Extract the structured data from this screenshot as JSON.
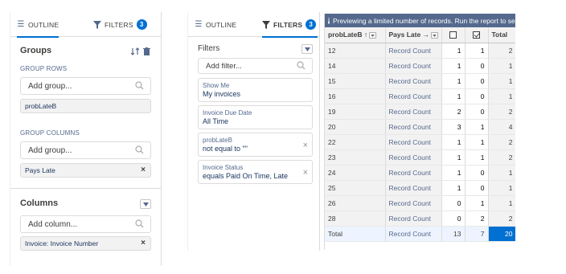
{
  "panel1": {
    "tabs": {
      "outline": "OUTLINE",
      "filters": "FILTERS",
      "filter_count": "3"
    },
    "groups": {
      "title": "Groups",
      "group_rows_label": "GROUP ROWS",
      "add_group_placeholder": "Add group...",
      "row_group": "probLateB",
      "group_columns_label": "GROUP COLUMNS",
      "column_group": "Pays Late"
    },
    "columns": {
      "title": "Columns",
      "add_column_placeholder": "Add column...",
      "column_item": "Invoice: Invoice Number"
    }
  },
  "panel2": {
    "tabs": {
      "outline": "OUTLINE",
      "filters": "FILTERS",
      "filter_count": "3"
    },
    "filters_title": "Filters",
    "add_filter_placeholder": "Add filter...",
    "filters": [
      {
        "label": "Show Me",
        "value": "My invoices"
      },
      {
        "label": "Invoice Due Date",
        "value": "All Time"
      },
      {
        "label": "probLateB",
        "value": "not equal to \"\""
      },
      {
        "label": "Invoice Status",
        "value": "equals Paid On Time, Late"
      }
    ]
  },
  "table": {
    "banner": "Previewing a limited number of records. Run the report to see",
    "headers": {
      "row_group": "probLateB",
      "col_group": "Pays Late",
      "total": "Total"
    },
    "rows": [
      {
        "key": "12",
        "measure": "Record Count",
        "unchecked": "1",
        "checked": "1",
        "total": "2"
      },
      {
        "key": "14",
        "measure": "Record Count",
        "unchecked": "1",
        "checked": "0",
        "total": "1"
      },
      {
        "key": "15",
        "measure": "Record Count",
        "unchecked": "1",
        "checked": "0",
        "total": "1"
      },
      {
        "key": "16",
        "measure": "Record Count",
        "unchecked": "1",
        "checked": "0",
        "total": "1"
      },
      {
        "key": "19",
        "measure": "Record Count",
        "unchecked": "2",
        "checked": "0",
        "total": "2"
      },
      {
        "key": "20",
        "measure": "Record Count",
        "unchecked": "3",
        "checked": "1",
        "total": "4"
      },
      {
        "key": "22",
        "measure": "Record Count",
        "unchecked": "1",
        "checked": "1",
        "total": "2"
      },
      {
        "key": "23",
        "measure": "Record Count",
        "unchecked": "1",
        "checked": "1",
        "total": "2"
      },
      {
        "key": "24",
        "measure": "Record Count",
        "unchecked": "1",
        "checked": "0",
        "total": "1"
      },
      {
        "key": "25",
        "measure": "Record Count",
        "unchecked": "1",
        "checked": "0",
        "total": "1"
      },
      {
        "key": "26",
        "measure": "Record Count",
        "unchecked": "0",
        "checked": "1",
        "total": "1"
      },
      {
        "key": "28",
        "measure": "Record Count",
        "unchecked": "0",
        "checked": "2",
        "total": "2"
      }
    ],
    "total_row": {
      "key": "Total",
      "measure": "Record Count",
      "unchecked": "13",
      "checked": "7",
      "total": "20"
    }
  }
}
